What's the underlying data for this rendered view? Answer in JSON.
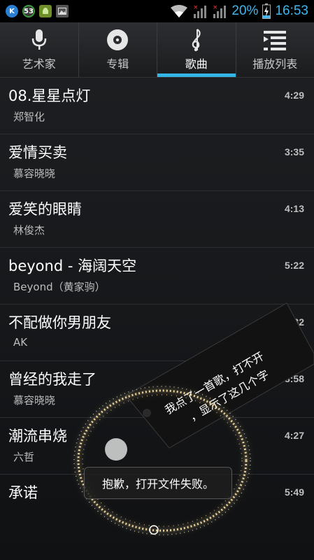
{
  "status_bar": {
    "battery": "20%",
    "time": "16:53"
  },
  "tabs": [
    {
      "label": "艺术家",
      "icon": "microphone-icon",
      "active": false
    },
    {
      "label": "专辑",
      "icon": "album-disc-icon",
      "active": false
    },
    {
      "label": "歌曲",
      "icon": "music-note-icon",
      "active": true
    },
    {
      "label": "播放列表",
      "icon": "playlist-icon",
      "active": false
    }
  ],
  "songs": [
    {
      "title": "08.星星点灯",
      "artist": "郑智化",
      "duration": "4:29"
    },
    {
      "title": "爱情买卖",
      "artist": "慕容晓晓",
      "duration": "3:35"
    },
    {
      "title": "爱笑的眼睛",
      "artist": "林俊杰",
      "duration": "4:13"
    },
    {
      "title": "beyond - 海阔天空",
      "artist": "Beyond（黄家驹）",
      "duration": "5:22"
    },
    {
      "title": "不配做你男朋友",
      "artist": "AK",
      "duration": "3:32"
    },
    {
      "title": "曾经的我走了",
      "artist": "慕容晓晓",
      "duration": "3:58"
    },
    {
      "title": "潮流串烧",
      "artist": "六哲",
      "duration": "4:27"
    },
    {
      "title": "承诺",
      "artist": "",
      "duration": "5:49"
    }
  ],
  "annotation": {
    "line1": "我点了一首歌，打不开",
    "line2": "，显示了这几个字"
  },
  "toast": "抱歉，打开文件失败。",
  "colors": {
    "accent": "#33b5e5",
    "status_text": "#3fb7ee"
  }
}
